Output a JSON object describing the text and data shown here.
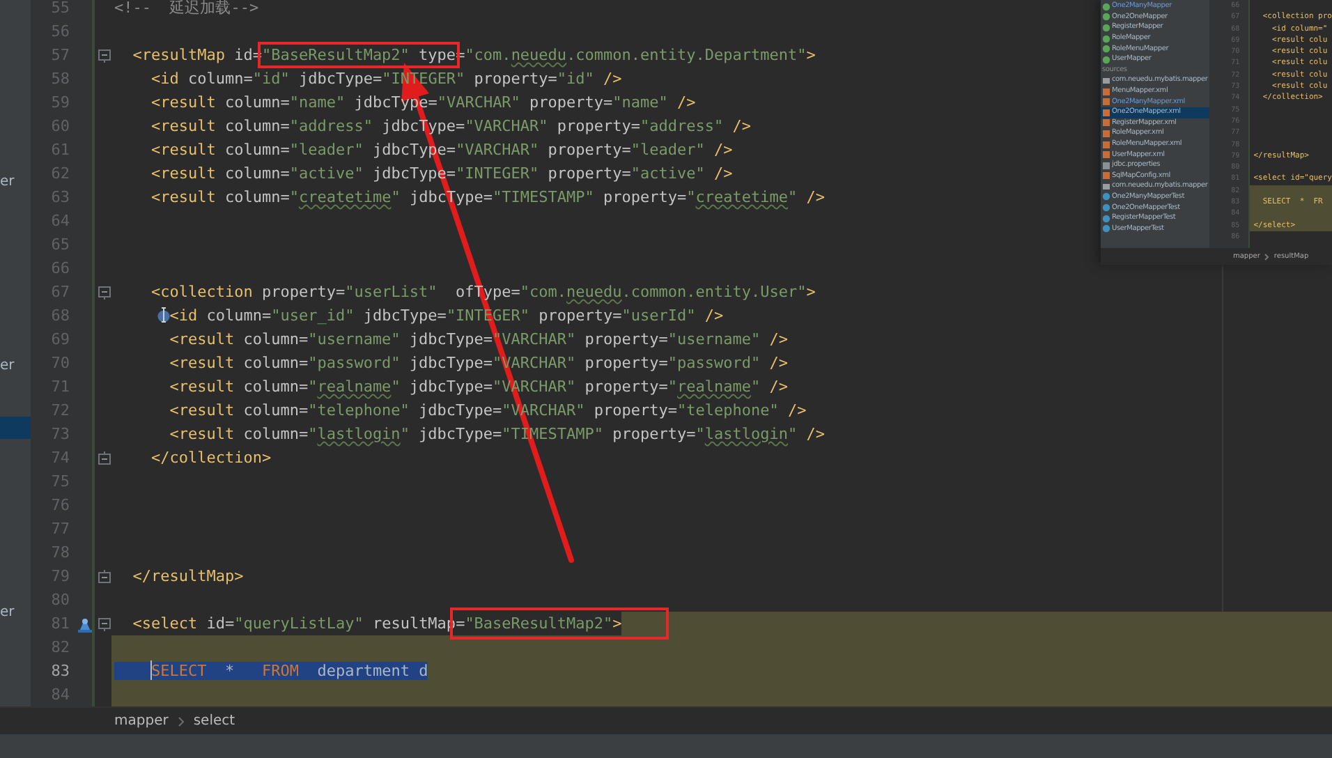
{
  "left_panel": {
    "items": [
      {
        "text": "er",
        "selected": false
      },
      {
        "text": "er",
        "selected": false
      },
      {
        "selected": true
      },
      {
        "text": "er",
        "selected": false
      }
    ]
  },
  "editor": {
    "lines": [
      {
        "number": "55",
        "tokens": [
          {
            "kind": "comment",
            "text": "<!--  延迟加载-->"
          }
        ]
      },
      {
        "number": "56"
      },
      {
        "number": "57",
        "fold_start": true,
        "tokens": [
          {
            "kind": "tag",
            "text": "  <resultMap "
          },
          {
            "kind": "attr",
            "text": "id="
          },
          {
            "kind": "value",
            "text": "\"BaseResultMap2\"",
            "boxed": true
          },
          {
            "kind": "attr",
            "text": " type",
            "boxed": true
          },
          {
            "kind": "attr",
            "text": "="
          },
          {
            "kind": "value",
            "text": "\"com."
          },
          {
            "kind": "value",
            "text": "neuedu",
            "typo": true
          },
          {
            "kind": "value",
            "text": ".common.entity.Department\""
          },
          {
            "kind": "tag",
            "text": ">"
          }
        ]
      },
      {
        "number": "58",
        "tokens": [
          {
            "kind": "tag",
            "text": "    <id "
          },
          {
            "kind": "attr",
            "text": "column="
          },
          {
            "kind": "value",
            "text": "\"id\""
          },
          {
            "kind": "attr",
            "text": " jdbcType="
          },
          {
            "kind": "value",
            "text": "\"INTEGER\""
          },
          {
            "kind": "attr",
            "text": " property="
          },
          {
            "kind": "value",
            "text": "\"id\""
          },
          {
            "kind": "tag",
            "text": " />"
          }
        ]
      },
      {
        "number": "59",
        "tokens": [
          {
            "kind": "tag",
            "text": "    <result "
          },
          {
            "kind": "attr",
            "text": "column="
          },
          {
            "kind": "value",
            "text": "\"name\""
          },
          {
            "kind": "attr",
            "text": " jdbcType="
          },
          {
            "kind": "value",
            "text": "\"VARCHAR\""
          },
          {
            "kind": "attr",
            "text": " property="
          },
          {
            "kind": "value",
            "text": "\"name\""
          },
          {
            "kind": "tag",
            "text": " />"
          }
        ]
      },
      {
        "number": "60",
        "tokens": [
          {
            "kind": "tag",
            "text": "    <result "
          },
          {
            "kind": "attr",
            "text": "column="
          },
          {
            "kind": "value",
            "text": "\"address\""
          },
          {
            "kind": "attr",
            "text": " jdbcType="
          },
          {
            "kind": "value",
            "text": "\"VARCHAR\""
          },
          {
            "kind": "attr",
            "text": " property="
          },
          {
            "kind": "value",
            "text": "\"address\""
          },
          {
            "kind": "tag",
            "text": " />"
          }
        ]
      },
      {
        "number": "61",
        "tokens": [
          {
            "kind": "tag",
            "text": "    <result "
          },
          {
            "kind": "attr",
            "text": "column="
          },
          {
            "kind": "value",
            "text": "\"leader\""
          },
          {
            "kind": "attr",
            "text": " jdbcType="
          },
          {
            "kind": "value",
            "text": "\"VARCHAR\""
          },
          {
            "kind": "attr",
            "text": " property="
          },
          {
            "kind": "value",
            "text": "\"leader\""
          },
          {
            "kind": "tag",
            "text": " />"
          }
        ]
      },
      {
        "number": "62",
        "tokens": [
          {
            "kind": "tag",
            "text": "    <result "
          },
          {
            "kind": "attr",
            "text": "column="
          },
          {
            "kind": "value",
            "text": "\"active\""
          },
          {
            "kind": "attr",
            "text": " jdbcType="
          },
          {
            "kind": "value",
            "text": "\"INTEGER\""
          },
          {
            "kind": "attr",
            "text": " property="
          },
          {
            "kind": "value",
            "text": "\"active\""
          },
          {
            "kind": "tag",
            "text": " />"
          }
        ]
      },
      {
        "number": "63",
        "tokens": [
          {
            "kind": "tag",
            "text": "    <result "
          },
          {
            "kind": "attr",
            "text": "column="
          },
          {
            "kind": "value",
            "text": "\""
          },
          {
            "kind": "value",
            "text": "createtime",
            "typo": true
          },
          {
            "kind": "value",
            "text": "\""
          },
          {
            "kind": "attr",
            "text": " jdbcType="
          },
          {
            "kind": "value",
            "text": "\"TIMESTAMP\""
          },
          {
            "kind": "attr",
            "text": " property="
          },
          {
            "kind": "value",
            "text": "\""
          },
          {
            "kind": "value",
            "text": "createtime",
            "typo": true
          },
          {
            "kind": "value",
            "text": "\""
          },
          {
            "kind": "tag",
            "text": " />"
          }
        ]
      },
      {
        "number": "64"
      },
      {
        "number": "65"
      },
      {
        "number": "66"
      },
      {
        "number": "67",
        "fold_start": true,
        "tokens": [
          {
            "kind": "tag",
            "text": "    <collection "
          },
          {
            "kind": "attr",
            "text": "property="
          },
          {
            "kind": "value",
            "text": "\"userList\""
          },
          {
            "kind": "attr",
            "text": "  ofType="
          },
          {
            "kind": "value",
            "text": "\"com."
          },
          {
            "kind": "value",
            "text": "neuedu",
            "typo": true
          },
          {
            "kind": "value",
            "text": ".common.entity.User\""
          },
          {
            "kind": "tag",
            "text": ">"
          }
        ]
      },
      {
        "number": "68",
        "cursor_marker": true,
        "tokens": [
          {
            "kind": "tag",
            "text": "      <id "
          },
          {
            "kind": "attr",
            "text": "column="
          },
          {
            "kind": "value",
            "text": "\"user_id\""
          },
          {
            "kind": "attr",
            "text": " jdbcType="
          },
          {
            "kind": "value",
            "text": "\"INTEGER\""
          },
          {
            "kind": "attr",
            "text": " property="
          },
          {
            "kind": "value",
            "text": "\"userId\""
          },
          {
            "kind": "tag",
            "text": " />"
          }
        ]
      },
      {
        "number": "69",
        "tokens": [
          {
            "kind": "tag",
            "text": "      <result "
          },
          {
            "kind": "attr",
            "text": "column="
          },
          {
            "kind": "value",
            "text": "\"username\""
          },
          {
            "kind": "attr",
            "text": " jdbcType="
          },
          {
            "kind": "value",
            "text": "\"VARCHAR\""
          },
          {
            "kind": "attr",
            "text": " property="
          },
          {
            "kind": "value",
            "text": "\"username\""
          },
          {
            "kind": "tag",
            "text": " />"
          }
        ]
      },
      {
        "number": "70",
        "tokens": [
          {
            "kind": "tag",
            "text": "      <result "
          },
          {
            "kind": "attr",
            "text": "column="
          },
          {
            "kind": "value",
            "text": "\"password\""
          },
          {
            "kind": "attr",
            "text": " jdbcType="
          },
          {
            "kind": "value",
            "text": "\"VARCHAR\""
          },
          {
            "kind": "attr",
            "text": " property="
          },
          {
            "kind": "value",
            "text": "\"password\""
          },
          {
            "kind": "tag",
            "text": " />"
          }
        ]
      },
      {
        "number": "71",
        "tokens": [
          {
            "kind": "tag",
            "text": "      <result "
          },
          {
            "kind": "attr",
            "text": "column="
          },
          {
            "kind": "value",
            "text": "\""
          },
          {
            "kind": "value",
            "text": "realname",
            "typo": true
          },
          {
            "kind": "value",
            "text": "\""
          },
          {
            "kind": "attr",
            "text": " jdbcType="
          },
          {
            "kind": "value",
            "text": "\"VARCHAR\""
          },
          {
            "kind": "attr",
            "text": " property="
          },
          {
            "kind": "value",
            "text": "\""
          },
          {
            "kind": "value",
            "text": "realname",
            "typo": true
          },
          {
            "kind": "value",
            "text": "\""
          },
          {
            "kind": "tag",
            "text": " />"
          }
        ]
      },
      {
        "number": "72",
        "tokens": [
          {
            "kind": "tag",
            "text": "      <result "
          },
          {
            "kind": "attr",
            "text": "column="
          },
          {
            "kind": "value",
            "text": "\"telephone\""
          },
          {
            "kind": "attr",
            "text": " jdbcType="
          },
          {
            "kind": "value",
            "text": "\"VARCHAR\""
          },
          {
            "kind": "attr",
            "text": " property="
          },
          {
            "kind": "value",
            "text": "\"telephone\""
          },
          {
            "kind": "tag",
            "text": " />"
          }
        ]
      },
      {
        "number": "73",
        "tokens": [
          {
            "kind": "tag",
            "text": "      <result "
          },
          {
            "kind": "attr",
            "text": "column="
          },
          {
            "kind": "value",
            "text": "\""
          },
          {
            "kind": "value",
            "text": "lastlogin",
            "typo": true
          },
          {
            "kind": "value",
            "text": "\""
          },
          {
            "kind": "attr",
            "text": " jdbcType="
          },
          {
            "kind": "value",
            "text": "\"TIMESTAMP\""
          },
          {
            "kind": "attr",
            "text": " property="
          },
          {
            "kind": "value",
            "text": "\""
          },
          {
            "kind": "value",
            "text": "lastlogin",
            "typo": true
          },
          {
            "kind": "value",
            "text": "\""
          },
          {
            "kind": "tag",
            "text": " />"
          }
        ]
      },
      {
        "number": "74",
        "fold_end": true,
        "tokens": [
          {
            "kind": "tag",
            "text": "    </collection>"
          }
        ]
      },
      {
        "number": "75"
      },
      {
        "number": "76"
      },
      {
        "number": "77"
      },
      {
        "number": "78"
      },
      {
        "number": "79",
        "fold_end": true,
        "tokens": [
          {
            "kind": "tag",
            "text": "  </resultMap>"
          }
        ]
      },
      {
        "number": "80"
      },
      {
        "number": "81",
        "fold_start": true,
        "gutter_icon": true,
        "highlight_tail": true,
        "tokens": [
          {
            "kind": "tag",
            "text": "  <select "
          },
          {
            "kind": "attr",
            "text": "id="
          },
          {
            "kind": "value",
            "text": "\"queryListLay\""
          },
          {
            "kind": "attr",
            "text": " resultMap"
          },
          {
            "kind": "attr",
            "text": "=",
            "boxed": true
          },
          {
            "kind": "value",
            "text": "\"BaseResultMap2\"",
            "boxed": true
          },
          {
            "kind": "tag",
            "text": ">",
            "boxed": true
          }
        ]
      },
      {
        "number": "82",
        "highlighted": true
      },
      {
        "number": "83",
        "highlighted": true,
        "current": true,
        "tokens": [
          {
            "kind": "keyword",
            "text": "    SELECT",
            "selected": true
          },
          {
            "kind": "plain",
            "text": "  *   ",
            "selected": true
          },
          {
            "kind": "keyword",
            "text": "FROM",
            "selected": true
          },
          {
            "kind": "plain",
            "text": "  department d",
            "selected": true
          }
        ]
      },
      {
        "number": "84",
        "highlighted": true
      }
    ]
  },
  "breadcrumb": [
    "mapper",
    "select"
  ],
  "callout_arrow": true,
  "inset": {
    "tree": [
      {
        "text": "One2ManyMapper",
        "kind": "interface",
        "modified": true,
        "selected": false
      },
      {
        "text": "One2OneMapper",
        "kind": "interface",
        "modified": false,
        "selected": false
      },
      {
        "text": "RegisterMapper",
        "kind": "interface",
        "modified": false,
        "selected": false
      },
      {
        "text": "RoleMapper",
        "kind": "interface",
        "modified": false,
        "selected": false
      },
      {
        "text": "RoleMenuMapper",
        "kind": "interface",
        "modified": false,
        "selected": false
      },
      {
        "text": "UserMapper",
        "kind": "interface",
        "modified": false,
        "selected": false
      },
      {
        "text": "sources",
        "kind": "section",
        "modified": false,
        "selected": false
      },
      {
        "text": "com.neuedu.mybatis.mapper",
        "kind": "package",
        "modified": false,
        "selected": false
      },
      {
        "text": "MenuMapper.xml",
        "kind": "xml",
        "modified": false,
        "selected": false
      },
      {
        "text": "One2ManyMapper.xml",
        "kind": "xml",
        "modified": true,
        "selected": false
      },
      {
        "text": "One2OneMapper.xml",
        "kind": "xml",
        "modified": false,
        "selected": true
      },
      {
        "text": "RegisterMapper.xml",
        "kind": "xml",
        "modified": false,
        "selected": false
      },
      {
        "text": "RoleMapper.xml",
        "kind": "xml",
        "modified": false,
        "selected": false
      },
      {
        "text": "RoleMenuMapper.xml",
        "kind": "xml",
        "modified": false,
        "selected": false
      },
      {
        "text": "UserMapper.xml",
        "kind": "xml",
        "modified": false,
        "selected": false
      },
      {
        "text": "jdbc.properties",
        "kind": "properties",
        "modified": false,
        "selected": false
      },
      {
        "text": "SqlMapConfig.xml",
        "kind": "xml",
        "modified": false,
        "selected": false
      },
      {
        "text": "com.neuedu.mybatis.mapper",
        "kind": "package",
        "modified": false,
        "selected": false
      },
      {
        "text": "One2ManyMapperTest",
        "kind": "test",
        "modified": false,
        "selected": false
      },
      {
        "text": "One2OneMapperTest",
        "kind": "test",
        "modified": false,
        "selected": false
      },
      {
        "text": "RegisterMapperTest",
        "kind": "test",
        "modified": false,
        "selected": false
      },
      {
        "text": "UserMapperTest",
        "kind": "test",
        "modified": false,
        "selected": false
      }
    ],
    "lines": [
      {
        "number": "66"
      },
      {
        "number": "67",
        "code": "  <collection pro"
      },
      {
        "number": "68",
        "code": "    <id column=\""
      },
      {
        "number": "69",
        "code": "    <result colu"
      },
      {
        "number": "70",
        "code": "    <result colu"
      },
      {
        "number": "71",
        "code": "    <result colu"
      },
      {
        "number": "72",
        "code": "    <result colu"
      },
      {
        "number": "73",
        "code": "    <result colu"
      },
      {
        "number": "74",
        "code": "  </collection>"
      },
      {
        "number": "75"
      },
      {
        "number": "76"
      },
      {
        "number": "77"
      },
      {
        "number": "78"
      },
      {
        "number": "79",
        "code": "</resultMap>"
      },
      {
        "number": "80"
      },
      {
        "number": "81",
        "code": "<select id=\"query"
      },
      {
        "number": "82",
        "highlighted": true
      },
      {
        "number": "83",
        "code": "  SELECT  *  FR",
        "highlighted": true
      },
      {
        "number": "84",
        "highlighted": true
      },
      {
        "number": "85",
        "code": "</select>",
        "highlighted": true
      },
      {
        "number": "86"
      }
    ],
    "breadcrumb": [
      "mapper",
      "resultMap"
    ]
  }
}
